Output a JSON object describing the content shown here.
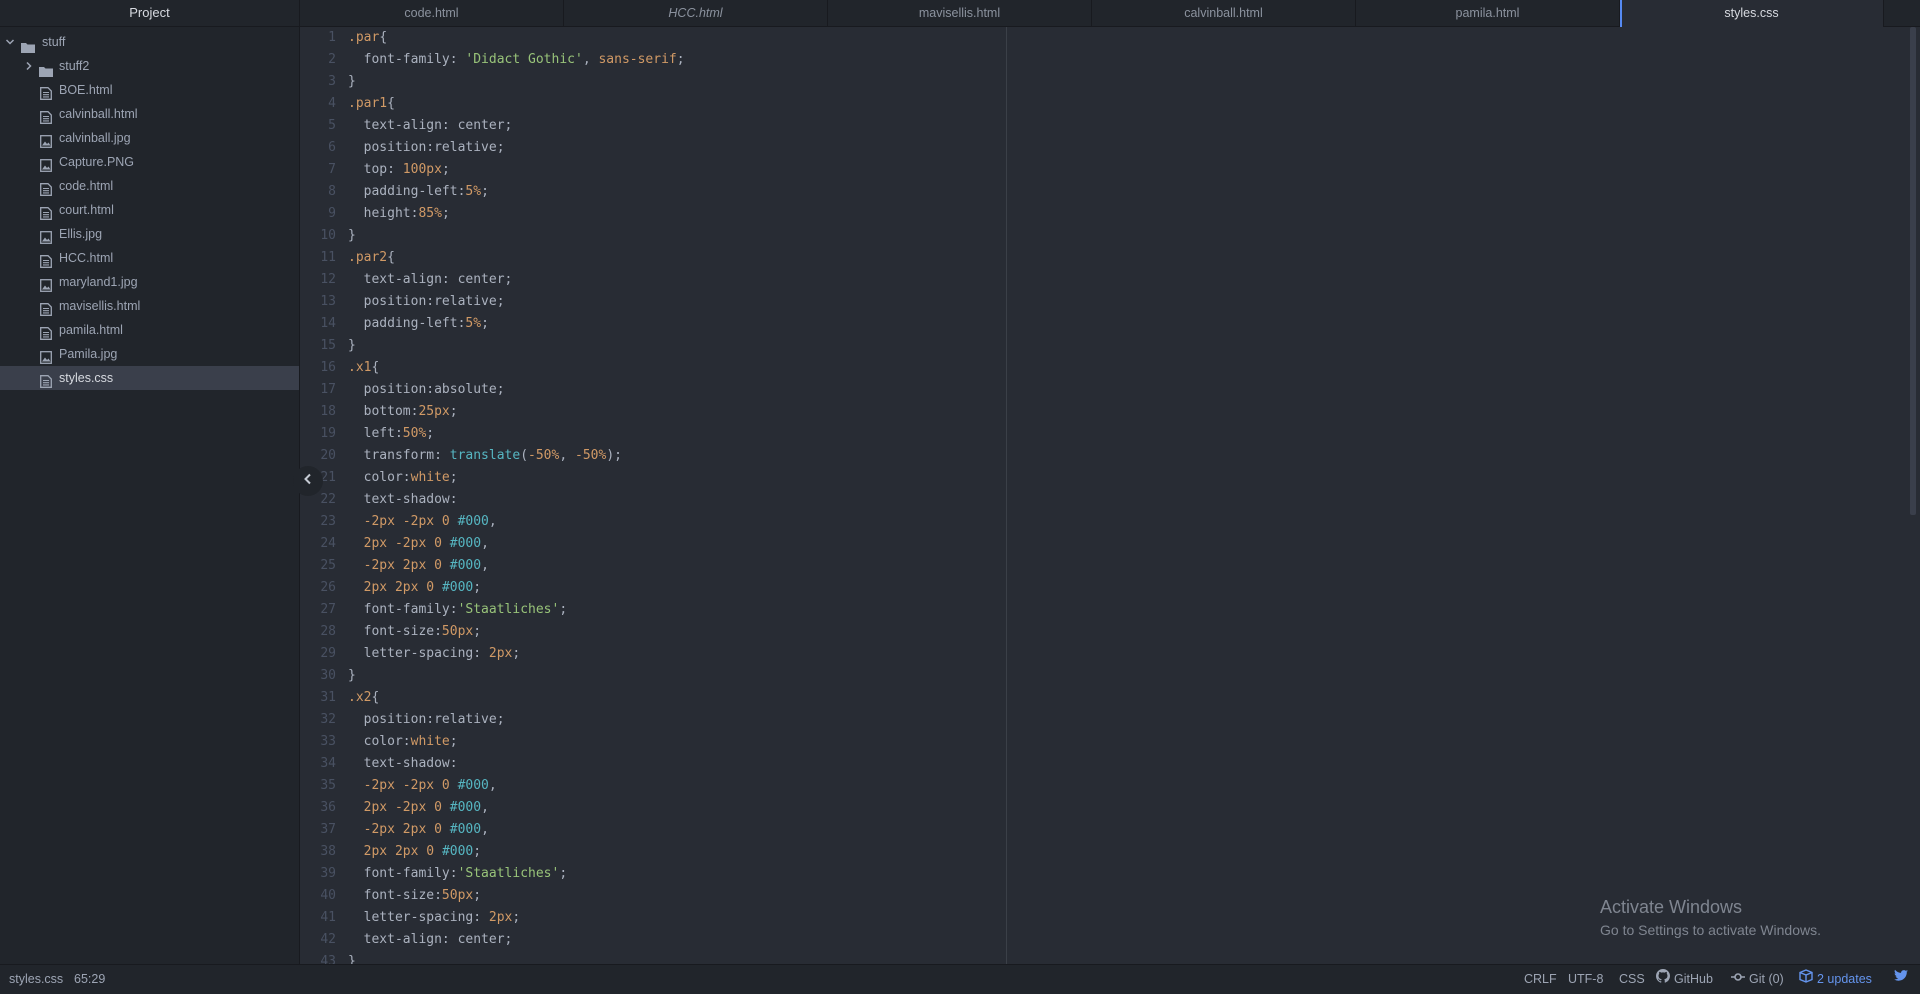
{
  "sidebar": {
    "header": "Project",
    "root": "stuff",
    "items": [
      {
        "label": "stuff2",
        "kind": "folder"
      },
      {
        "label": "BOE.html",
        "kind": "file"
      },
      {
        "label": "calvinball.html",
        "kind": "file"
      },
      {
        "label": "calvinball.jpg",
        "kind": "image"
      },
      {
        "label": "Capture.PNG",
        "kind": "image"
      },
      {
        "label": "code.html",
        "kind": "file"
      },
      {
        "label": "court.html",
        "kind": "file"
      },
      {
        "label": "Ellis.jpg",
        "kind": "image"
      },
      {
        "label": "HCC.html",
        "kind": "file"
      },
      {
        "label": "maryland1.jpg",
        "kind": "image"
      },
      {
        "label": "mavisellis.html",
        "kind": "file"
      },
      {
        "label": "pamila.html",
        "kind": "file"
      },
      {
        "label": "Pamila.jpg",
        "kind": "image"
      },
      {
        "label": "styles.css",
        "kind": "file",
        "selected": true
      }
    ]
  },
  "tabs": [
    {
      "label": "code.html"
    },
    {
      "label": "HCC.html",
      "italic": true
    },
    {
      "label": "mavisellis.html"
    },
    {
      "label": "calvinball.html"
    },
    {
      "label": "pamila.html"
    },
    {
      "label": "styles.css",
      "active": true
    }
  ],
  "editor": {
    "lines": [
      [
        [
          "sel",
          ".par"
        ],
        [
          "p",
          "{"
        ]
      ],
      [
        [
          "p",
          "  font-family: "
        ],
        [
          "str",
          "'Didact Gothic'"
        ],
        [
          "p",
          ", "
        ],
        [
          "kw",
          "sans-serif"
        ],
        [
          "p",
          ";"
        ]
      ],
      [
        [
          "p",
          "}"
        ]
      ],
      [
        [
          "sel",
          ".par1"
        ],
        [
          "p",
          "{"
        ]
      ],
      [
        [
          "p",
          "  text-align: center;"
        ]
      ],
      [
        [
          "p",
          "  position:relative;"
        ]
      ],
      [
        [
          "p",
          "  top: "
        ],
        [
          "num",
          "100px"
        ],
        [
          "p",
          ";"
        ]
      ],
      [
        [
          "p",
          "  padding-left:"
        ],
        [
          "num",
          "5%"
        ],
        [
          "p",
          ";"
        ]
      ],
      [
        [
          "p",
          "  height:"
        ],
        [
          "num",
          "85%"
        ],
        [
          "p",
          ";"
        ]
      ],
      [
        [
          "p",
          "}"
        ]
      ],
      [
        [
          "sel",
          ".par2"
        ],
        [
          "p",
          "{"
        ]
      ],
      [
        [
          "p",
          "  text-align: center;"
        ]
      ],
      [
        [
          "p",
          "  position:relative;"
        ]
      ],
      [
        [
          "p",
          "  padding-left:"
        ],
        [
          "num",
          "5%"
        ],
        [
          "p",
          ";"
        ]
      ],
      [
        [
          "p",
          "}"
        ]
      ],
      [
        [
          "sel",
          ".x1"
        ],
        [
          "p",
          "{"
        ]
      ],
      [
        [
          "p",
          "  position:absolute;"
        ]
      ],
      [
        [
          "p",
          "  bottom:"
        ],
        [
          "num",
          "25px"
        ],
        [
          "p",
          ";"
        ]
      ],
      [
        [
          "p",
          "  left:"
        ],
        [
          "num",
          "50%"
        ],
        [
          "p",
          ";"
        ]
      ],
      [
        [
          "p",
          "  transform: "
        ],
        [
          "fn",
          "translate"
        ],
        [
          "p",
          "("
        ],
        [
          "num",
          "-50%"
        ],
        [
          "p",
          ", "
        ],
        [
          "num",
          "-50%"
        ],
        [
          "p",
          ");"
        ]
      ],
      [
        [
          "p",
          "  color:"
        ],
        [
          "kw",
          "white"
        ],
        [
          "p",
          ";"
        ]
      ],
      [
        [
          "p",
          "  text-shadow:"
        ]
      ],
      [
        [
          "p",
          "  "
        ],
        [
          "num",
          "-2px -2px 0 "
        ],
        [
          "hash",
          "#000"
        ],
        [
          "p",
          ","
        ]
      ],
      [
        [
          "p",
          "  "
        ],
        [
          "num",
          "2px -2px 0 "
        ],
        [
          "hash",
          "#000"
        ],
        [
          "p",
          ","
        ]
      ],
      [
        [
          "p",
          "  "
        ],
        [
          "num",
          "-2px 2px 0 "
        ],
        [
          "hash",
          "#000"
        ],
        [
          "p",
          ","
        ]
      ],
      [
        [
          "p",
          "  "
        ],
        [
          "num",
          "2px 2px 0 "
        ],
        [
          "hash",
          "#000"
        ],
        [
          "p",
          ";"
        ]
      ],
      [
        [
          "p",
          "  font-family:"
        ],
        [
          "str",
          "'Staatliches'"
        ],
        [
          "p",
          ";"
        ]
      ],
      [
        [
          "p",
          "  font-size:"
        ],
        [
          "num",
          "50px"
        ],
        [
          "p",
          ";"
        ]
      ],
      [
        [
          "p",
          "  letter-spacing: "
        ],
        [
          "num",
          "2px"
        ],
        [
          "p",
          ";"
        ]
      ],
      [
        [
          "p",
          "}"
        ]
      ],
      [
        [
          "sel",
          ".x2"
        ],
        [
          "p",
          "{"
        ]
      ],
      [
        [
          "p",
          "  position:relative;"
        ]
      ],
      [
        [
          "p",
          "  color:"
        ],
        [
          "kw",
          "white"
        ],
        [
          "p",
          ";"
        ]
      ],
      [
        [
          "p",
          "  text-shadow:"
        ]
      ],
      [
        [
          "p",
          "  "
        ],
        [
          "num",
          "-2px -2px 0 "
        ],
        [
          "hash",
          "#000"
        ],
        [
          "p",
          ","
        ]
      ],
      [
        [
          "p",
          "  "
        ],
        [
          "num",
          "2px -2px 0 "
        ],
        [
          "hash",
          "#000"
        ],
        [
          "p",
          ","
        ]
      ],
      [
        [
          "p",
          "  "
        ],
        [
          "num",
          "-2px 2px 0 "
        ],
        [
          "hash",
          "#000"
        ],
        [
          "p",
          ","
        ]
      ],
      [
        [
          "p",
          "  "
        ],
        [
          "num",
          "2px 2px 0 "
        ],
        [
          "hash",
          "#000"
        ],
        [
          "p",
          ";"
        ]
      ],
      [
        [
          "p",
          "  font-family:"
        ],
        [
          "str",
          "'Staatliches'"
        ],
        [
          "p",
          ";"
        ]
      ],
      [
        [
          "p",
          "  font-size:"
        ],
        [
          "num",
          "50px"
        ],
        [
          "p",
          ";"
        ]
      ],
      [
        [
          "p",
          "  letter-spacing: "
        ],
        [
          "num",
          "2px"
        ],
        [
          "p",
          ";"
        ]
      ],
      [
        [
          "p",
          "  text-align: center;"
        ]
      ],
      [
        [
          "p",
          "}"
        ]
      ]
    ]
  },
  "watermark": {
    "title": "Activate Windows",
    "subtitle": "Go to Settings to activate Windows."
  },
  "status": {
    "file": "styles.css",
    "cursor": "65:29",
    "line_ending": "CRLF",
    "encoding": "UTF-8",
    "grammar": "CSS",
    "github": "GitHub",
    "git": "Git (0)",
    "updates": "2 updates"
  },
  "colors": {
    "accent": "#568af2",
    "selector": "#d19a66",
    "string": "#98c379",
    "function": "#56b6c2"
  }
}
